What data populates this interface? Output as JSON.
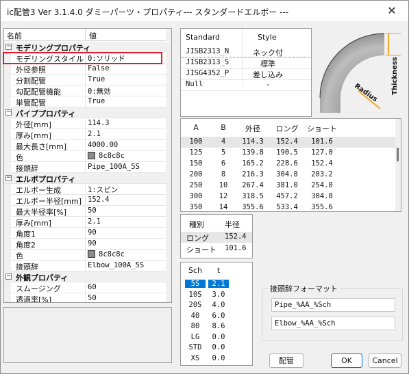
{
  "window": {
    "title": "ic配管3 Ver 3.1.4.0 ダミーパーツ・プロパティ--- スタンダードエルボー ---",
    "close_glyph": "✕"
  },
  "property_grid": {
    "headers": {
      "name": "名前",
      "value": "値"
    },
    "categories": [
      {
        "title": "モデリングプロパティ",
        "toggle": "−",
        "items": [
          {
            "name": "モデリングスタイル",
            "value": "0:ソリッド"
          },
          {
            "name": "外径参照",
            "value": "False"
          },
          {
            "name": "分割配管",
            "value": "True"
          },
          {
            "name": "勾配配管機能",
            "value": "0:無効"
          },
          {
            "name": "単管配管",
            "value": "True"
          }
        ]
      },
      {
        "title": "パイププロパティ",
        "toggle": "−",
        "items": [
          {
            "name": "外径[mm]",
            "value": "114.3"
          },
          {
            "name": "厚み[mm]",
            "value": "2.1"
          },
          {
            "name": "最大長さ[mm]",
            "value": "4000.00"
          },
          {
            "name": "色",
            "value": "8c8c8c",
            "swatch": "#8c8c8c"
          },
          {
            "name": "接頭辞",
            "value": "Pipe_100A_5S"
          }
        ]
      },
      {
        "title": "エルボプロパティ",
        "toggle": "−",
        "items": [
          {
            "name": "エルボー生成",
            "value": "1:スピン"
          },
          {
            "name": "エルボー半径[mm]",
            "value": "152.4"
          },
          {
            "name": "最大半径率[%]",
            "value": "50"
          },
          {
            "name": "厚み[mm]",
            "value": "2.1"
          },
          {
            "name": "角度1",
            "value": "90"
          },
          {
            "name": "角度2",
            "value": "90"
          },
          {
            "name": "色",
            "value": "8c8c8c",
            "swatch": "#8c8c8c"
          },
          {
            "name": "接頭辞",
            "value": "Elbow_100A_5S"
          }
        ]
      },
      {
        "title": "外観プロパティ",
        "toggle": "−",
        "items": [
          {
            "name": "スムージング",
            "value": "60"
          },
          {
            "name": "透過率[%]",
            "value": "50"
          }
        ]
      }
    ]
  },
  "standard_table": {
    "headers": {
      "standard": "Standard",
      "style": "Style"
    },
    "rows": [
      {
        "standard": "JISB2313_N",
        "style": "ネック付"
      },
      {
        "standard": "JISB2313_S",
        "style": "標準"
      },
      {
        "standard": "JISG4352_P",
        "style": "差し込み"
      },
      {
        "standard": "Null",
        "style": "-"
      }
    ],
    "selected_index": 1
  },
  "elbow_picture": {
    "radius_label": "Radius",
    "thickness_label": "Thickness"
  },
  "dimension_table": {
    "headers": [
      "A",
      "B",
      "外径",
      "ロング",
      "ショート"
    ],
    "rows": [
      [
        "100",
        "4",
        "114.3",
        "152.4",
        "101.6"
      ],
      [
        "125",
        "5",
        "139.8",
        "190.5",
        "127.0"
      ],
      [
        "150",
        "6",
        "165.2",
        "228.6",
        "152.4"
      ],
      [
        "200",
        "8",
        "216.3",
        "304.8",
        "203.2"
      ],
      [
        "250",
        "10",
        "267.4",
        "381.0",
        "254.0"
      ],
      [
        "300",
        "12",
        "318.5",
        "457.2",
        "304.8"
      ],
      [
        "350",
        "14",
        "355.6",
        "533.4",
        "355.6"
      ]
    ],
    "selected_index": 0
  },
  "kind_table": {
    "headers": {
      "kind": "種別",
      "radius": "半径"
    },
    "rows": [
      {
        "kind": "ロング",
        "radius": "152.4"
      },
      {
        "kind": "ショート",
        "radius": "101.6"
      }
    ],
    "selected_index": 0
  },
  "sch_table": {
    "headers": {
      "sch": "Sch",
      "t": "t"
    },
    "rows": [
      {
        "sch": "5S",
        "t": "2.1"
      },
      {
        "sch": "10S",
        "t": "3.0"
      },
      {
        "sch": "20S",
        "t": "4.0"
      },
      {
        "sch": "40",
        "t": "6.0"
      },
      {
        "sch": "80",
        "t": "8.6"
      },
      {
        "sch": "LG",
        "t": "0.0"
      },
      {
        "sch": "STD",
        "t": "0.0"
      },
      {
        "sch": "XS",
        "t": "0.0"
      }
    ],
    "selected_index": 0
  },
  "prefix_format": {
    "label": "接頭辞フォーマット",
    "pipe_value": "Pipe_%AA_%Sch",
    "elbow_value": "Elbow_%AA_%Sch"
  },
  "buttons": {
    "piping": "配管",
    "ok": "OK",
    "cancel": "Cancel"
  },
  "colors": {
    "highlight_box": "#e8192c",
    "selection_blue": "#0078d7",
    "elbow_gray": "#8c8c8c",
    "dimension_orange": "#f5a623"
  }
}
